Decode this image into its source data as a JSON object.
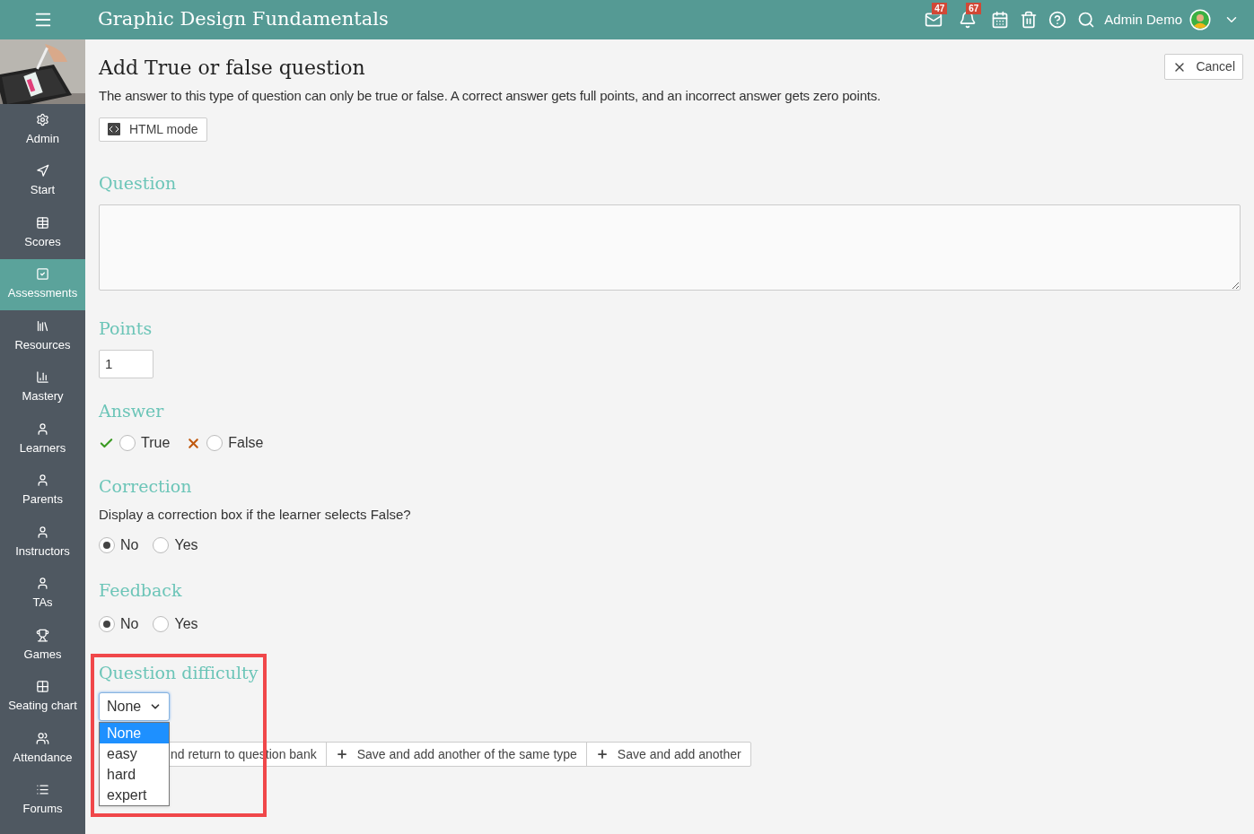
{
  "topbar": {
    "title": "Graphic Design Fundamentals",
    "mail_badge": "47",
    "bell_badge": "67",
    "user": "Admin Demo"
  },
  "sidebar": {
    "items": [
      {
        "label": "Admin",
        "selected": false
      },
      {
        "label": "Start",
        "selected": false
      },
      {
        "label": "Scores",
        "selected": false
      },
      {
        "label": "Assessments",
        "selected": true
      },
      {
        "label": "Resources",
        "selected": false
      },
      {
        "label": "Mastery",
        "selected": false
      },
      {
        "label": "Learners",
        "selected": false
      },
      {
        "label": "Parents",
        "selected": false
      },
      {
        "label": "Instructors",
        "selected": false
      },
      {
        "label": "TAs",
        "selected": false
      },
      {
        "label": "Games",
        "selected": false
      },
      {
        "label": "Seating chart",
        "selected": false
      },
      {
        "label": "Attendance",
        "selected": false
      },
      {
        "label": "Forums",
        "selected": false
      }
    ]
  },
  "page": {
    "title": "Add True or false question",
    "cancel": "Cancel",
    "description": "The answer to this type of question can only be true or false. A correct answer gets full points, and an incorrect answer gets zero points.",
    "html_mode": "HTML mode"
  },
  "question": {
    "heading": "Question"
  },
  "points": {
    "heading": "Points",
    "value": "1"
  },
  "answer": {
    "heading": "Answer",
    "options": [
      {
        "label": "True",
        "kind": "correct",
        "selected": false
      },
      {
        "label": "False",
        "kind": "incorrect",
        "selected": false
      }
    ]
  },
  "correction": {
    "heading": "Correction",
    "prompt": "Display a correction box if the learner selects False?",
    "options": [
      {
        "label": "No",
        "selected": true
      },
      {
        "label": "Yes",
        "selected": false
      }
    ]
  },
  "feedback": {
    "heading": "Feedback",
    "options": [
      {
        "label": "No",
        "selected": true
      },
      {
        "label": "Yes",
        "selected": false
      }
    ]
  },
  "difficulty": {
    "heading": "Question difficulty",
    "value": "None",
    "options": [
      {
        "label": "None",
        "selected": true
      },
      {
        "label": "easy",
        "selected": false
      },
      {
        "label": "hard",
        "selected": false
      },
      {
        "label": "expert",
        "selected": false
      }
    ]
  },
  "actions": [
    {
      "label": "nd return to question bank",
      "kind": "plain"
    },
    {
      "label": "Save and add another of the same type",
      "kind": "add"
    },
    {
      "label": "Save and add another",
      "kind": "add"
    }
  ]
}
